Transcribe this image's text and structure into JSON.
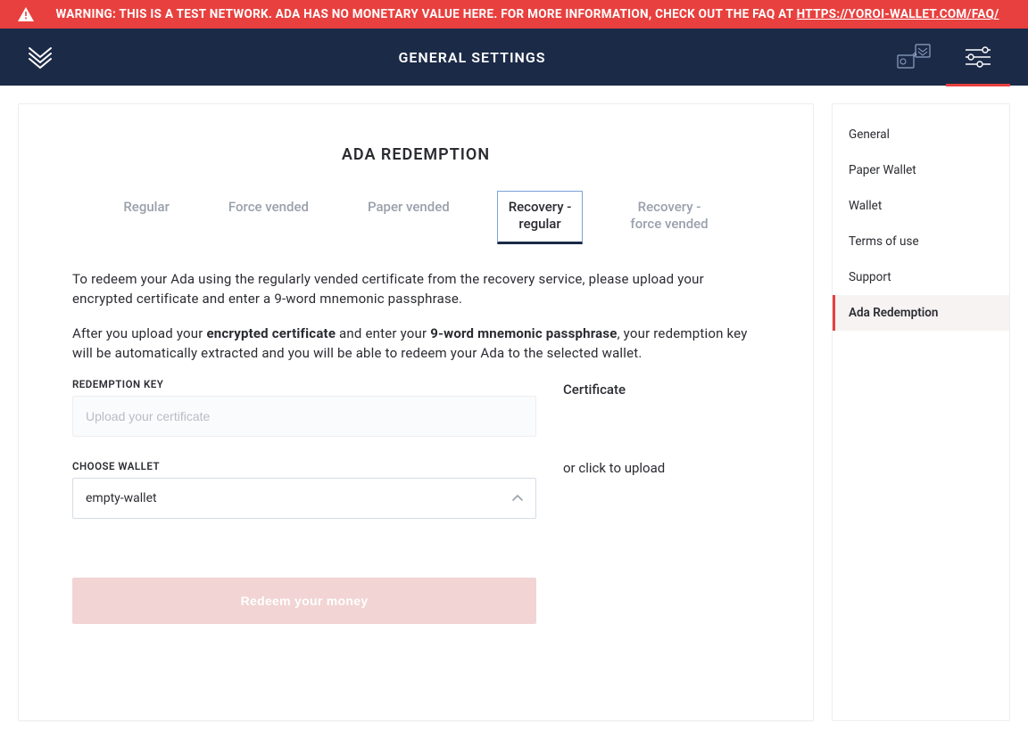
{
  "warning": {
    "prefix": "WARNING: THIS IS A TEST NETWORK. ADA HAS NO MONETARY VALUE HERE. FOR MORE INFORMATION, CHECK OUT THE FAQ AT ",
    "link_text": "HTTPS://YOROI-WALLET.COM/FAQ/"
  },
  "header": {
    "title": "GENERAL SETTINGS"
  },
  "page": {
    "title": "ADA REDEMPTION",
    "tabs": [
      "Regular",
      "Force vended",
      "Paper vended",
      "Recovery - regular",
      "Recovery - force vended"
    ],
    "active_tab_index": 3,
    "para1": "To redeem your Ada using the regularly vended certificate from the recovery service, please upload your encrypted certificate and enter a 9-word mnemonic passphrase.",
    "para2_pre": "After you upload your ",
    "para2_b1": "encrypted certificate",
    "para2_mid": " and enter your ",
    "para2_b2": "9-word mnemonic passphrase",
    "para2_post": ", your redemption key will be automatically extracted and you will be able to redeem your Ada to the selected wallet.",
    "redemption_key_label": "REDEMPTION KEY",
    "redemption_key_placeholder": "Upload your certificate",
    "choose_wallet_label": "CHOOSE WALLET",
    "choose_wallet_value": "empty-wallet",
    "certificate_title": "Certificate",
    "certificate_hint": "or click to upload",
    "redeem_button": "Redeem your money"
  },
  "sidebar": {
    "items": [
      "General",
      "Paper Wallet",
      "Wallet",
      "Terms of use",
      "Support",
      "Ada Redemption"
    ],
    "active_index": 5
  },
  "icons": {
    "logo": "yoroi-logo",
    "warn": "warning-triangle",
    "wallets": "wallets-icon",
    "settings": "settings-sliders-icon",
    "chevron_up": "chevron-up-icon"
  }
}
